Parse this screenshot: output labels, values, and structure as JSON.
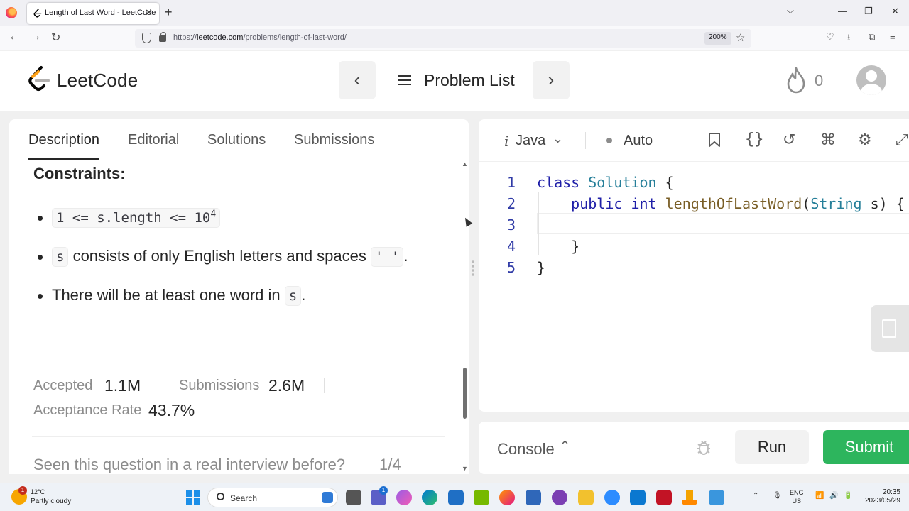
{
  "browser": {
    "tab_title": "Length of Last Word - LeetCode",
    "url_prefix": "https://",
    "url_host": "leetcode.com",
    "url_path": "/problems/length-of-last-word/",
    "zoom": "200%"
  },
  "header": {
    "logo_text": "LeetCode",
    "problem_list": "Problem List",
    "streak_count": "0"
  },
  "description_tabs": [
    "Description",
    "Editorial",
    "Solutions",
    "Submissions"
  ],
  "content": {
    "constraints_heading": "Constraints:",
    "c1_code": "1 <= s.length <= 10",
    "c1_sup": "4",
    "c2_code": "s",
    "c2_text": " consists of only English letters and spaces ",
    "c2_code2": "' '",
    "c2_end": ".",
    "c3_text": "There will be at least one word in ",
    "c3_code": "s",
    "c3_end": "."
  },
  "stats": {
    "accepted_label": "Accepted",
    "accepted_value": "1.1M",
    "submissions_label": "Submissions",
    "submissions_value": "2.6M",
    "rate_label": "Acceptance Rate",
    "rate_value": "43.7%"
  },
  "interview": {
    "question": "Seen this question in a real interview before?",
    "count": "1/4"
  },
  "editor": {
    "language": "Java",
    "mode": "Auto",
    "line_numbers": [
      "1",
      "2",
      "3",
      "4",
      "5"
    ],
    "code": {
      "l1_kw": "class",
      "l1_name": "Solution",
      "l1_brace": " {",
      "l2_public": "public",
      "l2_int": "int",
      "l2_fn": "lengthOfLastWord",
      "l2_open": "(",
      "l2_type": "String",
      "l2_rest": " s) {",
      "l4": "}",
      "l5": "}"
    }
  },
  "console": {
    "label": "Console",
    "run": "Run",
    "submit": "Submit"
  },
  "taskbar": {
    "temperature": "12°C",
    "condition": "Partly cloudy",
    "search": "Search",
    "lang_1": "ENG",
    "lang_2": "US",
    "time": "20:35",
    "date": "2023/05/29",
    "weather_badge": "1",
    "chat_badge": "1"
  }
}
